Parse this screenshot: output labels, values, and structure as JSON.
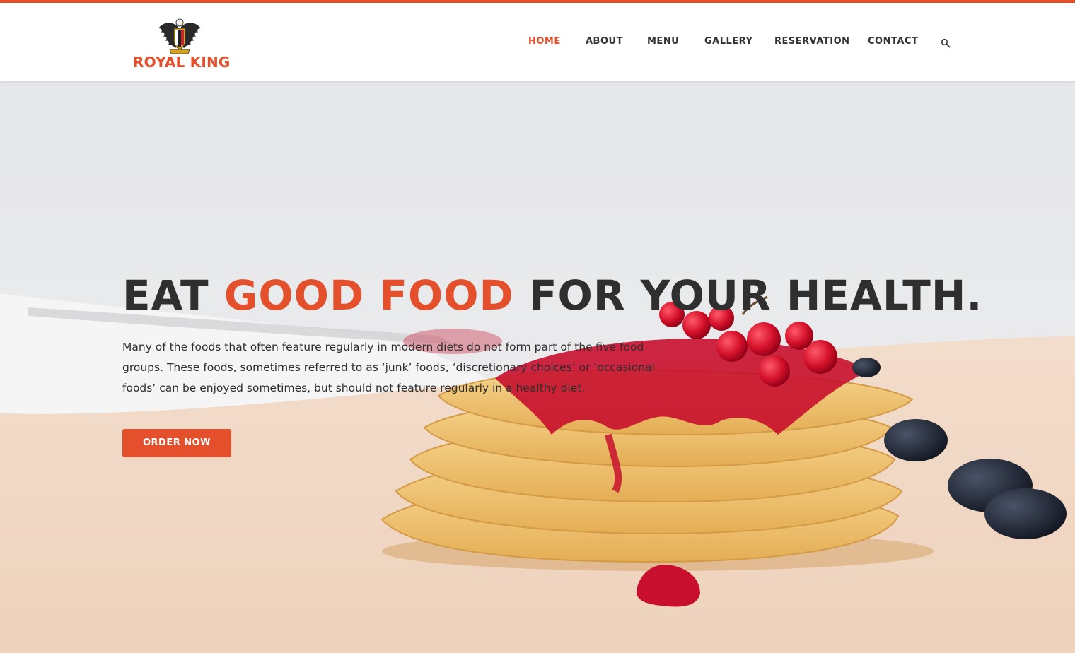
{
  "brand": {
    "name": "ROYAL KING",
    "logo_icon": "eagle-crest-icon",
    "accent_color": "#e4502b"
  },
  "nav": {
    "items": [
      {
        "label": "HOME",
        "active": true
      },
      {
        "label": "ABOUT",
        "active": false
      },
      {
        "label": "MENU",
        "active": false
      },
      {
        "label": "GALLERY",
        "active": false
      },
      {
        "label": "RESERVATION",
        "active": false
      },
      {
        "label": "CONTACT",
        "active": false
      }
    ],
    "search_icon": "search-icon"
  },
  "hero": {
    "title_part1": "EAT ",
    "title_accent": "GOOD FOOD",
    "title_part2": " FOR YOUR HEALTH.",
    "description": "Many of the foods that often feature regularly in modern diets do not form part of the five food groups. These foods, sometimes referred to as ‘junk’ foods, ‘discretionary choices’ or ‘occasional foods’ can be enjoyed sometimes, but should not feature regularly in a healthy diet.",
    "cta_label": "ORDER NOW",
    "background_image": "waffles-with-berry-jam"
  }
}
